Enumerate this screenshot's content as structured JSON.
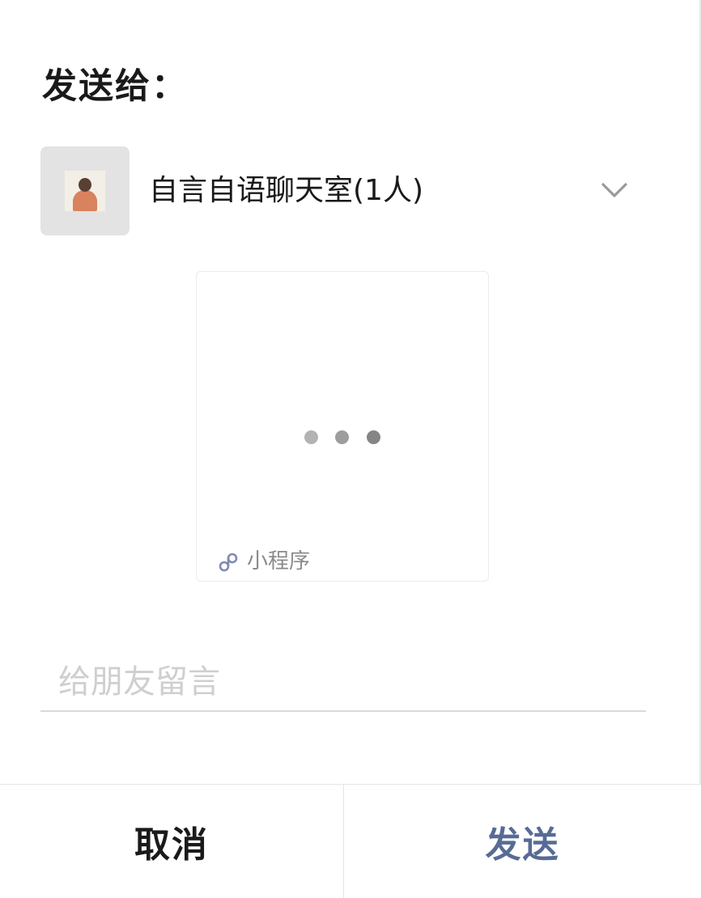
{
  "dialog": {
    "title": "发送给："
  },
  "recipient": {
    "name": "自言自语聊天室(1人)",
    "avatar_icon": "person-photo",
    "expand_icon": "chevron-down-icon"
  },
  "mini_program_card": {
    "loading_icon": "loading-dots",
    "link_icon": "mini-program-link-icon",
    "label": "小程序"
  },
  "message": {
    "placeholder": "给朋友留言",
    "value": ""
  },
  "actions": {
    "cancel_label": "取消",
    "send_label": "发送"
  },
  "colors": {
    "send_accent": "#576b95",
    "text_primary": "#1a1a1a",
    "placeholder": "#cfcfcf"
  }
}
